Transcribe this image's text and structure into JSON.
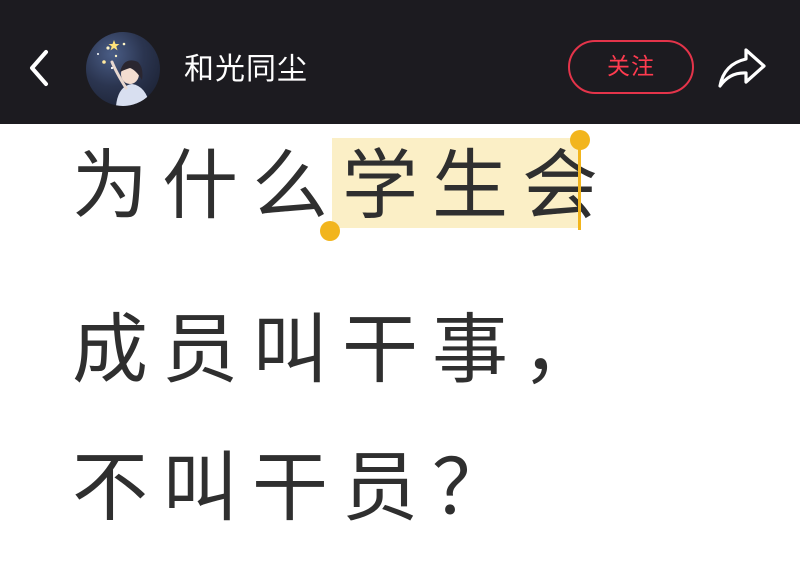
{
  "header": {
    "back_icon": "chevron-left-icon",
    "username": "和光同尘",
    "follow_label": "关注",
    "share_icon": "share-arrow-icon",
    "colors": {
      "bar_background": "#1c1b20",
      "follow_accent": "#e4344a"
    }
  },
  "post": {
    "line1_prefix": "为什么",
    "line1_selected": "学生会",
    "line2": "成员叫干事，",
    "line3": "不叫干员？",
    "selection_color": "#fbefc6",
    "selection_handle_color": "#f2b51d"
  }
}
